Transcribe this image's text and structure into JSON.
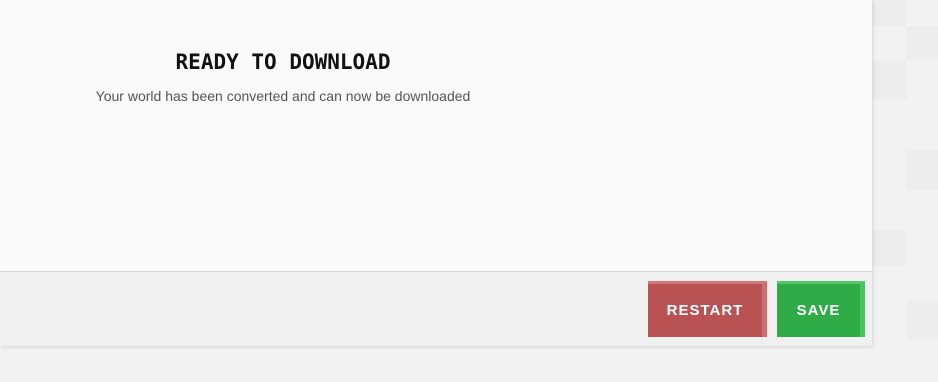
{
  "dialog": {
    "title": "READY TO DOWNLOAD",
    "subtitle": "Your world has been converted and can now be downloaded"
  },
  "footer": {
    "restart_label": "RESTART",
    "save_label": "SAVE"
  },
  "colors": {
    "restart": "#b95252",
    "save": "#2fac48",
    "panel": "#fafafa",
    "footer": "#f0f0f0"
  }
}
